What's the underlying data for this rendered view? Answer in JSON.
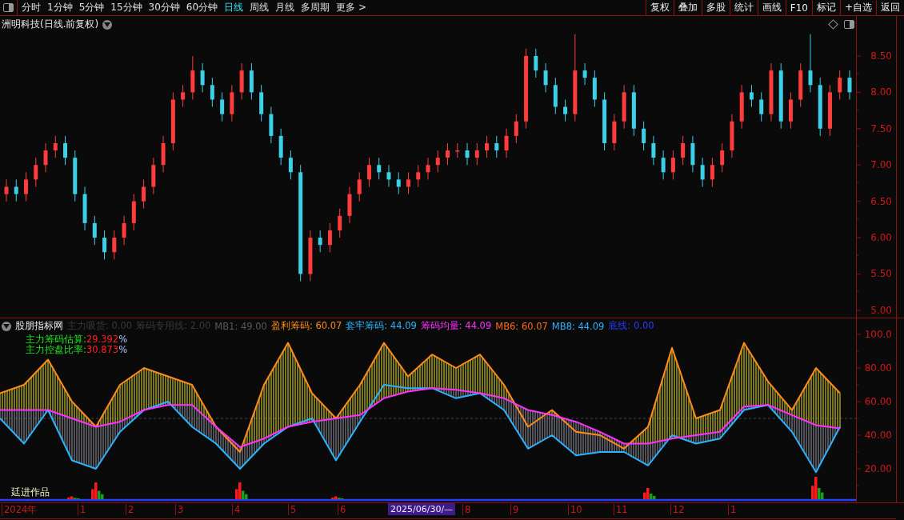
{
  "toolbar": {
    "periods": [
      {
        "label": "分时",
        "selected": false
      },
      {
        "label": "1分钟",
        "selected": false
      },
      {
        "label": "5分钟",
        "selected": false
      },
      {
        "label": "15分钟",
        "selected": false
      },
      {
        "label": "30分钟",
        "selected": false
      },
      {
        "label": "60分钟",
        "selected": false
      },
      {
        "label": "日线",
        "selected": true
      },
      {
        "label": "周线",
        "selected": false
      },
      {
        "label": "月线",
        "selected": false
      },
      {
        "label": "多周期",
        "selected": false
      },
      {
        "label": "更多 >",
        "selected": false
      }
    ],
    "buttons": [
      "复权",
      "叠加",
      "多股",
      "统计",
      "画线",
      "F10",
      "标记",
      "+自选",
      "返回"
    ]
  },
  "price_panel": {
    "title": "洲明科技(日线.前复权)",
    "chart_data": {
      "type": "candlestick",
      "ylim": [
        4.9,
        9.05
      ],
      "yticks": [
        {
          "value": 8.5,
          "label": "8.50"
        },
        {
          "value": 8,
          "label": "8.00"
        },
        {
          "value": 7.5,
          "label": "7.50"
        },
        {
          "value": 7,
          "label": "7.00"
        },
        {
          "value": 6.5,
          "label": "6.50"
        },
        {
          "value": 6,
          "label": "6.00"
        },
        {
          "value": 5.5,
          "label": "5.50"
        },
        {
          "value": 5,
          "label": "5.00"
        }
      ],
      "ohlc": [
        [
          6.6,
          6.8,
          6.5,
          6.7
        ],
        [
          6.7,
          6.8,
          6.5,
          6.6
        ],
        [
          6.6,
          6.9,
          6.5,
          6.8
        ],
        [
          6.8,
          7.1,
          6.7,
          7.0
        ],
        [
          7.0,
          7.3,
          6.9,
          7.2
        ],
        [
          7.2,
          7.4,
          7.1,
          7.3
        ],
        [
          7.3,
          7.4,
          7.0,
          7.1
        ],
        [
          7.1,
          7.2,
          6.5,
          6.6
        ],
        [
          6.6,
          6.7,
          6.1,
          6.2
        ],
        [
          6.2,
          6.3,
          5.9,
          6.0
        ],
        [
          6.0,
          6.1,
          5.7,
          5.8
        ],
        [
          5.8,
          6.1,
          5.7,
          6.0
        ],
        [
          6.0,
          6.3,
          5.9,
          6.2
        ],
        [
          6.2,
          6.6,
          6.1,
          6.5
        ],
        [
          6.5,
          6.8,
          6.4,
          6.7
        ],
        [
          6.7,
          7.1,
          6.6,
          7.0
        ],
        [
          7.0,
          7.4,
          6.9,
          7.3
        ],
        [
          7.3,
          8.0,
          7.2,
          7.9
        ],
        [
          7.9,
          8.1,
          7.8,
          8.0
        ],
        [
          8.0,
          8.5,
          7.9,
          8.3
        ],
        [
          8.3,
          8.4,
          8.0,
          8.1
        ],
        [
          8.1,
          8.2,
          7.8,
          7.9
        ],
        [
          7.9,
          8.0,
          7.6,
          7.7
        ],
        [
          7.7,
          8.1,
          7.6,
          8.0
        ],
        [
          8.0,
          8.4,
          7.9,
          8.3
        ],
        [
          8.3,
          8.4,
          7.9,
          8.0
        ],
        [
          8.0,
          8.1,
          7.6,
          7.7
        ],
        [
          7.7,
          7.8,
          7.3,
          7.4
        ],
        [
          7.4,
          7.5,
          7.0,
          7.1
        ],
        [
          7.1,
          7.2,
          6.8,
          6.9
        ],
        [
          6.9,
          7.0,
          5.4,
          5.5
        ],
        [
          5.5,
          6.1,
          5.4,
          6.0
        ],
        [
          6.0,
          6.1,
          5.8,
          5.9
        ],
        [
          5.9,
          6.2,
          5.8,
          6.1
        ],
        [
          6.1,
          6.4,
          6.0,
          6.3
        ],
        [
          6.3,
          6.7,
          6.2,
          6.6
        ],
        [
          6.6,
          6.9,
          6.5,
          6.8
        ],
        [
          6.8,
          7.1,
          6.7,
          7.0
        ],
        [
          7.0,
          7.1,
          6.8,
          6.9
        ],
        [
          6.9,
          7.0,
          6.7,
          6.8
        ],
        [
          6.8,
          6.9,
          6.6,
          6.7
        ],
        [
          6.7,
          6.9,
          6.6,
          6.8
        ],
        [
          6.8,
          7.0,
          6.7,
          6.9
        ],
        [
          6.9,
          7.1,
          6.8,
          7.0
        ],
        [
          7.0,
          7.2,
          6.9,
          7.1
        ],
        [
          7.1,
          7.3,
          7.0,
          7.2
        ],
        [
          7.2,
          7.3,
          7.1,
          7.2
        ],
        [
          7.2,
          7.3,
          7.0,
          7.1
        ],
        [
          7.1,
          7.3,
          7.0,
          7.2
        ],
        [
          7.2,
          7.4,
          7.1,
          7.3
        ],
        [
          7.3,
          7.4,
          7.1,
          7.2
        ],
        [
          7.2,
          7.5,
          7.1,
          7.4
        ],
        [
          7.4,
          7.7,
          7.3,
          7.6
        ],
        [
          7.6,
          8.6,
          7.5,
          8.5
        ],
        [
          8.5,
          8.6,
          8.2,
          8.3
        ],
        [
          8.3,
          8.4,
          8.0,
          8.1
        ],
        [
          8.1,
          8.2,
          7.7,
          7.8
        ],
        [
          7.8,
          7.9,
          7.6,
          7.7
        ],
        [
          7.7,
          8.8,
          7.6,
          8.3
        ],
        [
          8.3,
          8.4,
          8.1,
          8.2
        ],
        [
          8.2,
          8.3,
          7.8,
          7.9
        ],
        [
          7.9,
          8.0,
          7.2,
          7.3
        ],
        [
          7.3,
          7.7,
          7.2,
          7.6
        ],
        [
          7.6,
          8.1,
          7.5,
          8.0
        ],
        [
          8.0,
          8.1,
          7.4,
          7.5
        ],
        [
          7.5,
          7.6,
          7.2,
          7.3
        ],
        [
          7.3,
          7.4,
          7.0,
          7.1
        ],
        [
          7.1,
          7.2,
          6.8,
          6.9
        ],
        [
          6.9,
          7.2,
          6.8,
          7.1
        ],
        [
          7.1,
          7.4,
          7.0,
          7.3
        ],
        [
          7.3,
          7.4,
          6.9,
          7.0
        ],
        [
          7.0,
          7.1,
          6.7,
          6.8
        ],
        [
          6.8,
          7.1,
          6.7,
          7.0
        ],
        [
          7.0,
          7.3,
          6.9,
          7.2
        ],
        [
          7.2,
          7.7,
          7.1,
          7.6
        ],
        [
          7.6,
          8.1,
          7.5,
          8.0
        ],
        [
          8.0,
          8.1,
          7.8,
          7.9
        ],
        [
          7.9,
          8.0,
          7.6,
          7.7
        ],
        [
          7.7,
          8.4,
          7.6,
          8.3
        ],
        [
          8.3,
          8.4,
          7.5,
          7.6
        ],
        [
          7.6,
          8.0,
          7.5,
          7.9
        ],
        [
          7.9,
          8.4,
          7.8,
          8.3
        ],
        [
          8.3,
          8.8,
          8.0,
          8.1
        ],
        [
          8.1,
          8.2,
          7.4,
          7.5
        ],
        [
          7.5,
          8.1,
          7.4,
          8.0
        ],
        [
          8.0,
          8.3,
          7.9,
          8.2
        ],
        [
          8.2,
          8.3,
          7.9,
          8.0
        ]
      ]
    }
  },
  "indicator_panel": {
    "title": "股朋指标网",
    "separator": ":",
    "legend_before": [
      {
        "label": "主力吸货",
        "value": "0.00",
        "color": "#3a3a3a"
      },
      {
        "label": "筹码专用线",
        "value": "2.00",
        "color": "#3a3a3a"
      },
      {
        "label": "MB1",
        "value": "49.00",
        "color": "#5a5a5a"
      }
    ],
    "legend_after": [
      {
        "label": "MB6",
        "value": "60.07",
        "color": "#ff6a1a"
      },
      {
        "label": "MB8",
        "value": "44.09",
        "color": "#2ab4ff"
      },
      {
        "label": "底线",
        "value": "0.00",
        "color": "#2a3cff"
      }
    ],
    "estimates": [
      {
        "label": "主力筹码估算:",
        "value": "29.392",
        "unit": "%"
      },
      {
        "label": "主力控盘比率:",
        "value": "30.873",
        "unit": "%"
      }
    ],
    "author": "廷进作品",
    "series_readings": [
      "60.07",
      "44.09",
      "44.09"
    ],
    "chart_data": {
      "type": "line",
      "ylim": [
        0,
        109.5
      ],
      "yticks": [
        {
          "value": 100,
          "label": "100.0"
        },
        {
          "value": 80,
          "label": "80.00"
        },
        {
          "value": 60,
          "label": "60.00"
        },
        {
          "value": 40,
          "label": "40.00"
        },
        {
          "value": 20,
          "label": "20.00"
        }
      ],
      "series": [
        {
          "name": "盈利筹码",
          "color": "#ff8c1a",
          "values": [
            65,
            70,
            85,
            60,
            45,
            70,
            80,
            75,
            70,
            45,
            30,
            70,
            95,
            65,
            50,
            70,
            95,
            75,
            88,
            80,
            88,
            70,
            45,
            55,
            42,
            40,
            32,
            45,
            92,
            50,
            55,
            95,
            72,
            55,
            80,
            65
          ]
        },
        {
          "name": "套牢筹码",
          "color": "#2ab4ff",
          "values": [
            50,
            35,
            55,
            25,
            20,
            42,
            55,
            60,
            45,
            35,
            20,
            35,
            45,
            50,
            25,
            48,
            70,
            68,
            68,
            62,
            65,
            55,
            32,
            40,
            28,
            30,
            30,
            22,
            40,
            35,
            38,
            55,
            58,
            42,
            18,
            45
          ]
        },
        {
          "name": "筹码均量",
          "color": "#ff30ff",
          "values": [
            55,
            55,
            55,
            50,
            45,
            48,
            55,
            58,
            58,
            45,
            33,
            38,
            45,
            48,
            50,
            52,
            62,
            66,
            68,
            67,
            65,
            62,
            55,
            52,
            48,
            42,
            35,
            35,
            38,
            40,
            42,
            57,
            58,
            52,
            46,
            44
          ]
        }
      ]
    }
  },
  "date_axis": [
    {
      "label": "2024年",
      "kind": "tick"
    },
    {
      "label": "1",
      "kind": "tick"
    },
    {
      "label": "2",
      "kind": "tick"
    },
    {
      "label": "3",
      "kind": "tick"
    },
    {
      "label": "4",
      "kind": "tick"
    },
    {
      "label": "5",
      "kind": "tick"
    },
    {
      "label": "6",
      "kind": "tick"
    },
    {
      "label": "2025/06/30/—",
      "kind": "cursor"
    },
    {
      "label": "8",
      "kind": "tick"
    },
    {
      "label": "9",
      "kind": "tick"
    },
    {
      "label": "10",
      "kind": "tick"
    },
    {
      "label": "11",
      "kind": "tick"
    },
    {
      "label": "12",
      "kind": "tick"
    },
    {
      "label": "1",
      "kind": "tick"
    }
  ]
}
